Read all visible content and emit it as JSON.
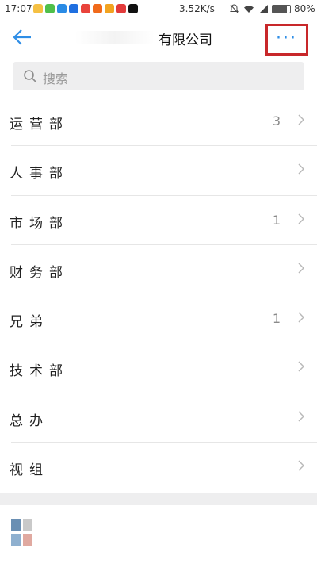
{
  "status_bar": {
    "time": "17:07",
    "speed": "3.52K/s",
    "battery_pct": "80%",
    "battery_level": 0.8,
    "app_icon_colors": [
      "#f5c043",
      "#4fbf4a",
      "#2a8be5",
      "#1f6fe0",
      "#e9433b",
      "#f06a1b",
      "#f2a320",
      "#e23b3b",
      "#111111"
    ]
  },
  "header": {
    "title": "有限公司",
    "more_label": "···"
  },
  "search": {
    "placeholder": "搜索"
  },
  "departments": [
    {
      "name": "运营",
      "suffix": "部",
      "count": "3"
    },
    {
      "name": "人事",
      "suffix": "部",
      "count": ""
    },
    {
      "name": "市场",
      "suffix": "部",
      "count": "1"
    },
    {
      "name": "财务",
      "suffix": "部",
      "count": ""
    },
    {
      "name": "兄弟",
      "suffix": "",
      "count": "1"
    },
    {
      "name": "技术",
      "suffix": "部",
      "count": ""
    },
    {
      "name": "总",
      "suffix": "办",
      "count": ""
    },
    {
      "name": "视",
      "suffix": "组",
      "count": ""
    }
  ],
  "colors": {
    "accent": "#2f8ee6",
    "highlight_border": "#c8282a",
    "divider": "#e6e6e6",
    "search_bg": "#eeeeef"
  }
}
